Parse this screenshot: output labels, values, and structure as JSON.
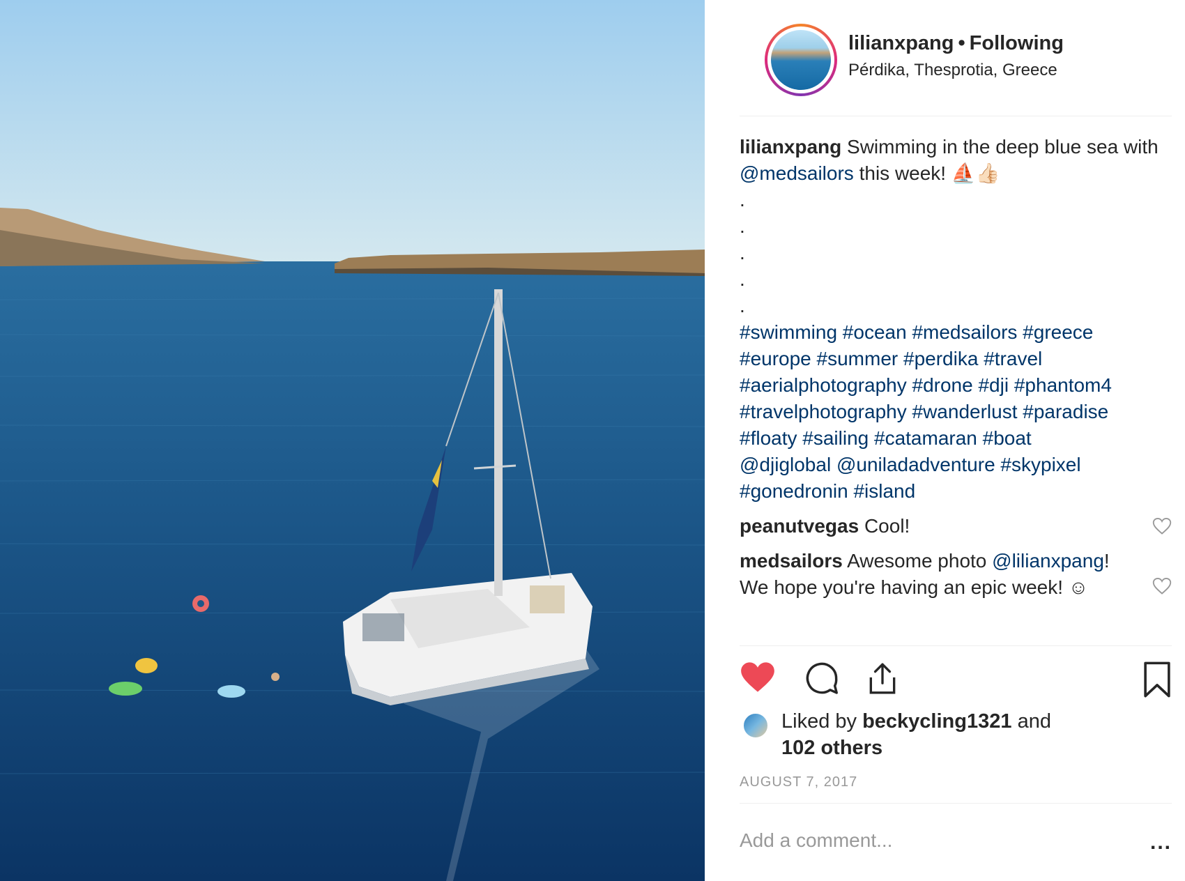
{
  "post": {
    "username": "lilianxpang",
    "separator": "•",
    "follow_status": "Following",
    "location": "Pérdika, Thesprotia, Greece",
    "caption": {
      "user": "lilianxpang",
      "text_part1": "Swimming in the deep blue sea with",
      "mention": "@medsailors",
      "text_part2": "this week!",
      "emoji": "⛵👍🏻",
      "dots": [
        ".",
        ".",
        ".",
        ".",
        "."
      ],
      "hashtags_lines": [
        "#swimming #ocean #medsailors #greece",
        "#europe #summer #perdika #travel",
        "#aerialphotography #drone #dji #phantom4",
        "#travelphotography #wanderlust #paradise",
        "#floaty #sailing #catamaran #boat",
        "@djiglobal @uniladadventure #skypixel",
        "#gonedronin #island"
      ]
    },
    "comments": [
      {
        "user": "peanutvegas",
        "text": "Cool!"
      },
      {
        "user": "medsailors",
        "text_part1": "Awesome photo",
        "mention": "@lilianxpang",
        "text_part2": "! We hope you're having an epic week! ☺"
      }
    ],
    "likes": {
      "prefix": "Liked by",
      "user": "beckycling1321",
      "and": "and",
      "others": "102 others"
    },
    "date": "AUGUST 7, 2017",
    "add_comment_placeholder": "Add a comment...",
    "more_label": "..."
  },
  "icons": {
    "like": "heart-filled-icon",
    "comment": "comment-bubble-icon",
    "share": "share-icon",
    "save": "bookmark-icon",
    "comment_like": "heart-outline-icon"
  },
  "colors": {
    "liked_heart": "#ed4956",
    "link": "#003569",
    "muted": "#999999"
  }
}
